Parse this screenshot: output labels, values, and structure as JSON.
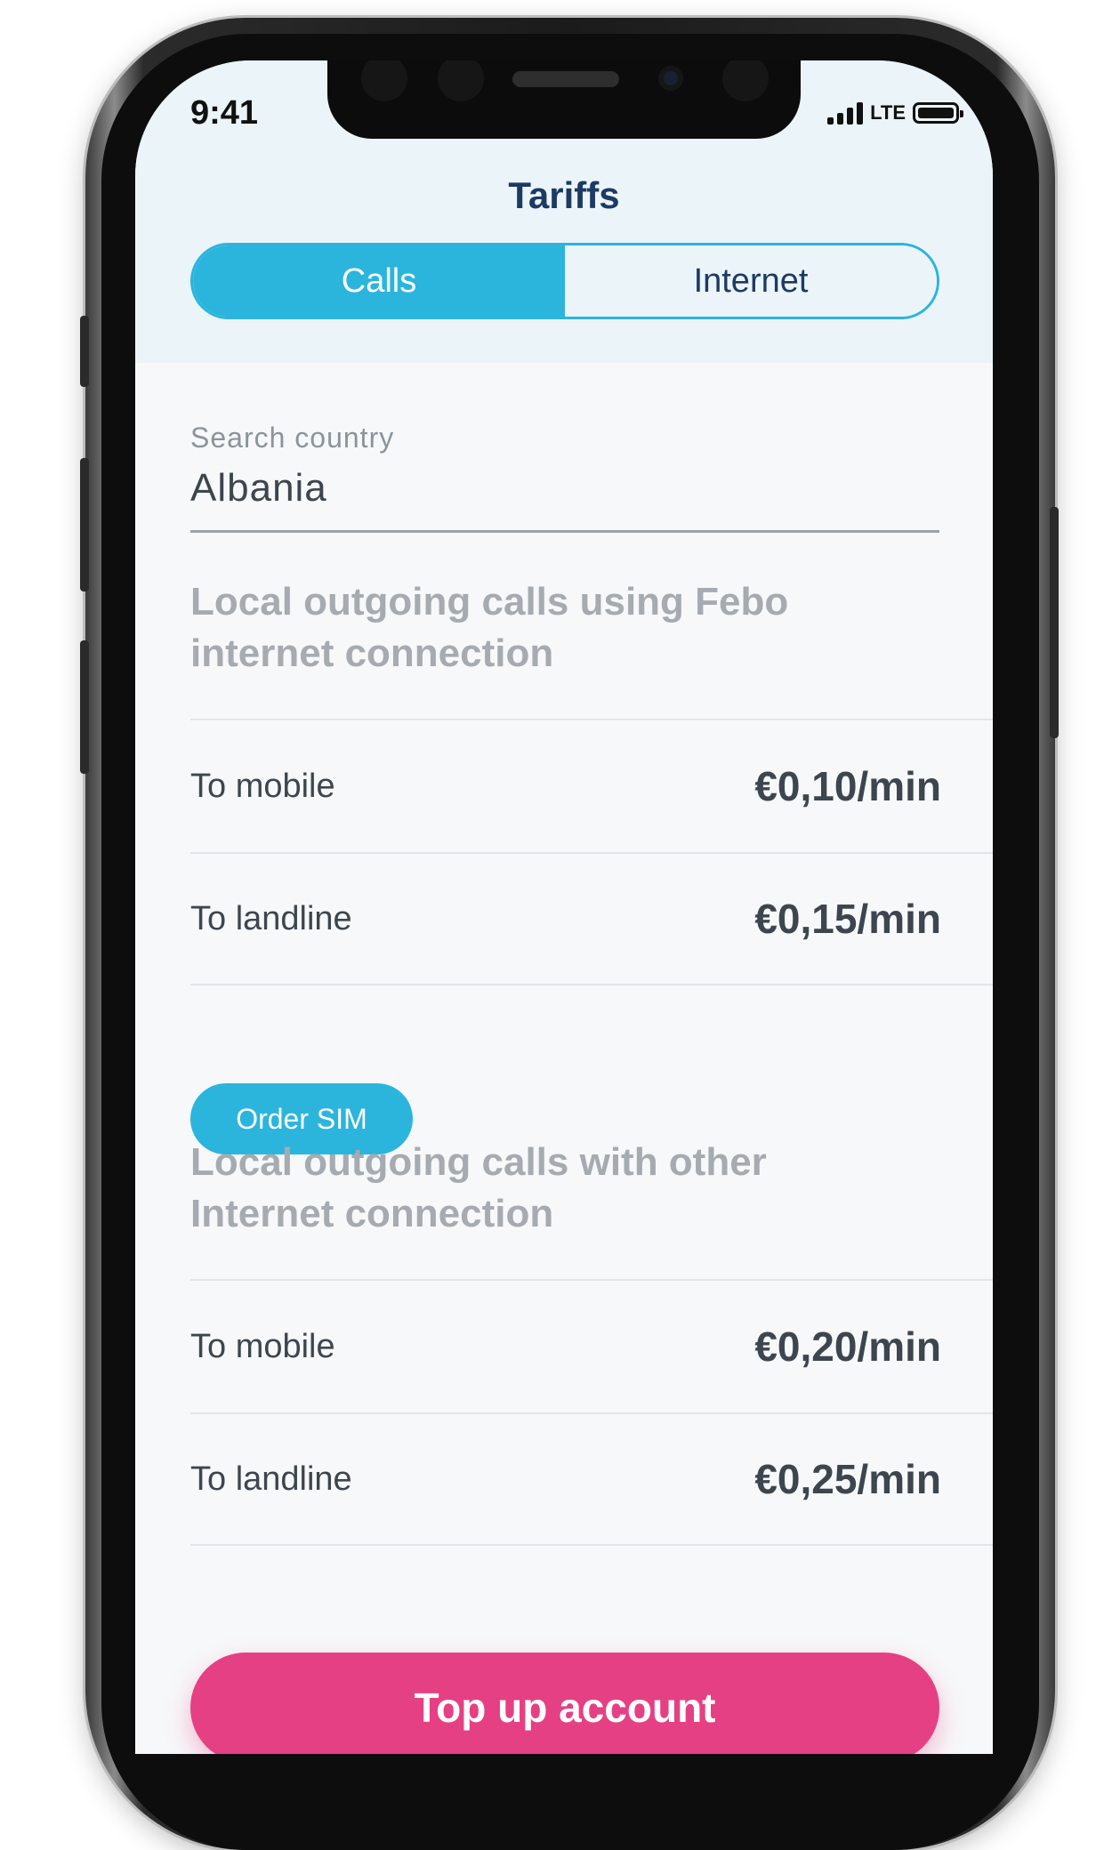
{
  "status_bar": {
    "time": "9:41",
    "network": "LTE"
  },
  "header": {
    "title": "Tariffs"
  },
  "tabs": [
    {
      "label": "Calls",
      "active": true
    },
    {
      "label": "Internet",
      "active": false
    }
  ],
  "search": {
    "label": "Search country",
    "value": "Albania"
  },
  "sections": [
    {
      "heading": "Local outgoing calls using Febo internet connection",
      "rows": [
        {
          "label": "To mobile",
          "price": "€0,10/min"
        },
        {
          "label": "To landline",
          "price": "€0,15/min"
        }
      ]
    },
    {
      "heading": "Local outgoing calls with other Internet connection",
      "rows": [
        {
          "label": "To mobile",
          "price": "€0,20/min"
        },
        {
          "label": "To landline",
          "price": "€0,25/min"
        }
      ]
    }
  ],
  "order_sim_label": "Order SIM",
  "topup_label": "Top up account",
  "colors": {
    "accent": "#2bb5dd",
    "primary_text": "#1c3a63",
    "cta": "#e54083",
    "header_bg": "#ebf4f8"
  }
}
